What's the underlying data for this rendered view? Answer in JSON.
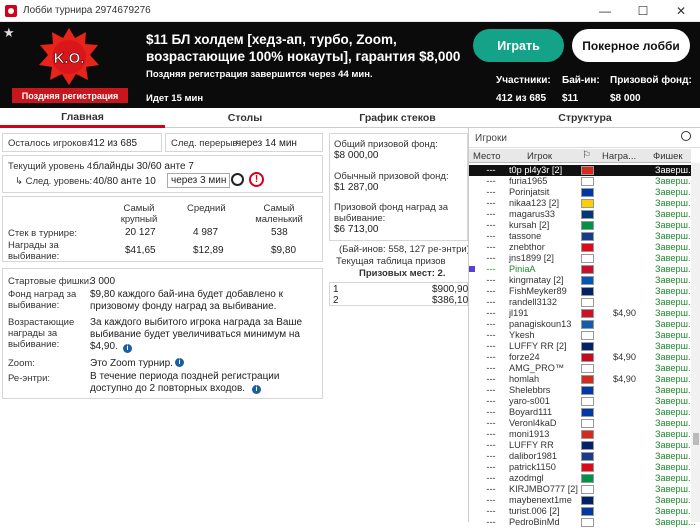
{
  "window": {
    "title": "Лобби турнира 2974679276"
  },
  "header": {
    "late_label": "Поздняя регистрация",
    "tournament_name": "$11 БЛ холдем [хедз-ап, турбо, Zoom, возрастающие 100% нокауты], гарантия $8,000",
    "late_reg_info": "Поздняя регистрация завершится через 44 мин.",
    "running": "Идет 15 мин",
    "play_button": "Играть",
    "lobby_button": "Покерное лобби",
    "participants_label": "Участники:",
    "participants_value": "412 из 685",
    "buyin_label": "Бай-ин:",
    "buyin_value": "$11",
    "prize_label": "Призовой фонд:",
    "prize_value": "$8 000"
  },
  "tabs": [
    "Главная",
    "Столы",
    "График стеков",
    "Структура"
  ],
  "left": {
    "remaining_label": "Осталось игроков:",
    "remaining_value": "412 из 685",
    "break_label": "След. перерыв:",
    "break_value": "через 14 мин",
    "level_label": "Текущий уровень 4:",
    "level_value": "блайнды 30/60 анте 7",
    "next_label": "↳ След. уровень:",
    "next_value": "40/80 анте 10",
    "next_time": "через 3 мин",
    "col_largest": "Самый крупный",
    "col_avg": "Средний",
    "col_small": "Самый маленький",
    "stack_label": "Стек в турнире:",
    "stack_largest": "20 127",
    "stack_avg": "4 987",
    "stack_small": "538",
    "bounty_label": "Награды за выбивание:",
    "bounty_largest": "$41,65",
    "bounty_avg": "$12,89",
    "bounty_small": "$9,80",
    "chips_label": "Стартовые фишки:",
    "chips_value": "3 000",
    "fund_label": "Фонд наград за выбивание:",
    "fund_value": "$9,80 каждого бай-ина будет добавлено к призовому фонду наград за выбивание.",
    "prog_label": "Возрастающие награды за выбивание:",
    "prog_value": "За каждого выбитого игрока награда за Ваше выбивание будет увеличиваться минимум на $4,90.",
    "zoom_label": "Zoom:",
    "zoom_value": "Это Zoom турнир.",
    "reentry_label": "Ре-энтри:",
    "reentry_value": "В течение периода поздней регистрации доступно до 2 повторных входов."
  },
  "middle": {
    "total_label": "Общий призовой фонд:",
    "total_value": "$8 000,00",
    "regular_label": "Обычный призовой фонд:",
    "regular_value": "$1 287,00",
    "bounty_label": "Призовой фонд наград за выбивание:",
    "bounty_value": "$6 713,00",
    "buyins": "(Бай-инов: 558, 127 ре-энтри)",
    "table_label": "Текущая таблица призов",
    "places": "Призовых мест: 2.",
    "payouts": [
      {
        "place": "1",
        "amount": "$900,90"
      },
      {
        "place": "2",
        "amount": "$386,10"
      }
    ]
  },
  "players": {
    "search_placeholder": "Игроки",
    "col_place": "Место",
    "col_player": "Игрок",
    "col_bounty": "Награ...",
    "col_chips": "Фишек",
    "rows": [
      {
        "place": "---",
        "name": "t0p pl4y3r [2]",
        "bounty": "",
        "chips": "Заверш...",
        "hl": "black"
      },
      {
        "place": "---",
        "name": "furia1965",
        "bounty": "",
        "chips": "Заверш..."
      },
      {
        "place": "---",
        "name": "Porinjatsit",
        "bounty": "",
        "chips": "Заверш..."
      },
      {
        "place": "---",
        "name": "nikaa123 [2]",
        "bounty": "",
        "chips": "Заверш..."
      },
      {
        "place": "---",
        "name": "magarus33",
        "bounty": "",
        "chips": "Заверш..."
      },
      {
        "place": "---",
        "name": "kursah [2]",
        "bounty": "",
        "chips": "Заверш..."
      },
      {
        "place": "---",
        "name": "tassone",
        "bounty": "",
        "chips": "Заверш..."
      },
      {
        "place": "---",
        "name": "znebthor",
        "bounty": "",
        "chips": "Заверш..."
      },
      {
        "place": "---",
        "name": "jns1899 [2]",
        "bounty": "",
        "chips": "Заверш..."
      },
      {
        "place": "---",
        "name": "PiniaA",
        "bounty": "",
        "chips": "Заверш...",
        "hl": "green"
      },
      {
        "place": "---",
        "name": "kingmatay [2]",
        "bounty": "",
        "chips": "Заверш..."
      },
      {
        "place": "---",
        "name": "FishMeyker89",
        "bounty": "",
        "chips": "Заверш..."
      },
      {
        "place": "---",
        "name": "randell3132",
        "bounty": "",
        "chips": "Заверш..."
      },
      {
        "place": "---",
        "name": "jl191",
        "bounty": "$4,90",
        "chips": "Заверш..."
      },
      {
        "place": "---",
        "name": "panagiskoun13",
        "bounty": "",
        "chips": "Заверш..."
      },
      {
        "place": "---",
        "name": "Ykesh",
        "bounty": "",
        "chips": "Заверш..."
      },
      {
        "place": "---",
        "name": "LUFFY RR [2]",
        "bounty": "",
        "chips": "Заверш..."
      },
      {
        "place": "---",
        "name": "forze24",
        "bounty": "$4,90",
        "chips": "Заверш..."
      },
      {
        "place": "---",
        "name": "AMG_PRO™",
        "bounty": "",
        "chips": "Заверш..."
      },
      {
        "place": "---",
        "name": "homlah",
        "bounty": "$4,90",
        "chips": "Заверш..."
      },
      {
        "place": "---",
        "name": "Shelebbrs",
        "bounty": "",
        "chips": "Заверш..."
      },
      {
        "place": "---",
        "name": "yaro-s001",
        "bounty": "",
        "chips": "Заверш..."
      },
      {
        "place": "---",
        "name": "Boyard111",
        "bounty": "",
        "chips": "Заверш..."
      },
      {
        "place": "---",
        "name": "Veronl4kaD",
        "bounty": "",
        "chips": "Заверш..."
      },
      {
        "place": "---",
        "name": "moni1913",
        "bounty": "",
        "chips": "Заверш..."
      },
      {
        "place": "---",
        "name": "LUFFY RR",
        "bounty": "",
        "chips": "Заверш..."
      },
      {
        "place": "---",
        "name": "dalibor1981",
        "bounty": "",
        "chips": "Заверш..."
      },
      {
        "place": "---",
        "name": "patrick1150",
        "bounty": "",
        "chips": "Заверш..."
      },
      {
        "place": "---",
        "name": "azodmgl",
        "bounty": "",
        "chips": "Заверш..."
      },
      {
        "place": "---",
        "name": "KIRJMBO777 [2]",
        "bounty": "",
        "chips": "Заверш..."
      },
      {
        "place": "---",
        "name": "maybenext1me",
        "bounty": "",
        "chips": "Заверш..."
      },
      {
        "place": "---",
        "name": "turist.006 [2]",
        "bounty": "",
        "chips": "Заверш..."
      },
      {
        "place": "---",
        "name": "PedroBinMd",
        "bounty": "",
        "chips": "Заверш..."
      }
    ]
  },
  "flags": [
    "#d52b1e",
    "#ffffff",
    "#0039a6",
    "#ffce00",
    "#003580",
    "#009246",
    "#1a3a8a",
    "#e30a17",
    "#ffffff",
    "#c8102e",
    "#0057b7",
    "#012169",
    "#ffffff",
    "#ce1126",
    "#0d5eaf",
    "#ffffff",
    "#012169",
    "#c60b1e",
    "#ffffff",
    "#d52b1e",
    "#0039a6",
    "#ffffff",
    "#0039a6",
    "#ffffff",
    "#d52b1e",
    "#012169",
    "#1a3a8a",
    "#e30a17",
    "#009246",
    "#ffffff",
    "#012169",
    "#0039a6",
    "#ffffff"
  ]
}
